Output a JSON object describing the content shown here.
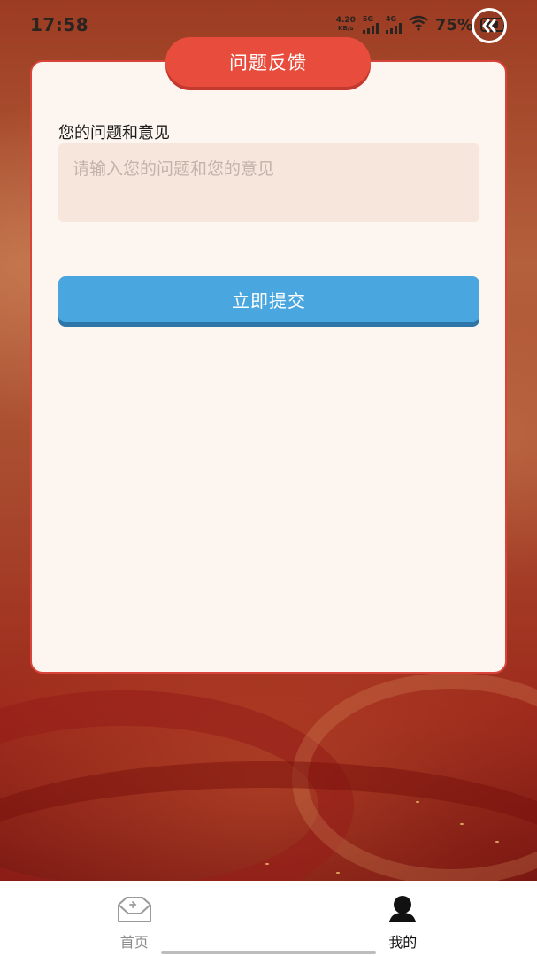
{
  "status_bar": {
    "time": "17:58",
    "net_speed_value": "4.20",
    "net_speed_unit": "KB/s",
    "signal_1_label": "5G",
    "signal_2_label": "4G",
    "battery_percent": "75%"
  },
  "page": {
    "title": "问题反馈"
  },
  "form": {
    "field_label": "您的问题和意见",
    "input_value": "",
    "input_placeholder": "请输入您的问题和您的意见",
    "submit_label": "立即提交"
  },
  "bottom_nav": {
    "items": [
      {
        "label": "首页",
        "icon": "home-icon",
        "active": false
      },
      {
        "label": "我的",
        "icon": "user-icon",
        "active": true
      }
    ]
  },
  "colors": {
    "title_tab": "#e84c3d",
    "card_border": "#d8433a",
    "card_background": "#fdf5ef",
    "input_background": "#f7e6dc",
    "submit_button": "#4aa6df"
  }
}
